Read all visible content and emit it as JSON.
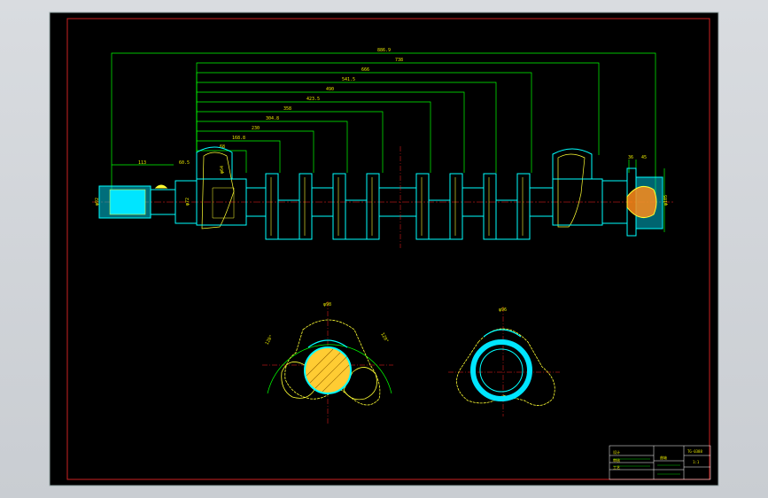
{
  "dimensions": {
    "overall": "886.9",
    "d738": "738",
    "d666": "666",
    "d541": "541.5",
    "d490": "490",
    "d423": "423.5",
    "d358": "358",
    "d304": "304.8",
    "d230": "230",
    "d168": "168.8",
    "d68": "68",
    "left_len": "113",
    "left_step": "60.5",
    "left_dia": "φ92",
    "left_mid": "φ72",
    "web_mid": "φ64",
    "right_a": "36",
    "right_b": "45",
    "right_dia": "φ105"
  },
  "section_views": {
    "left_top": "φ98",
    "left_angle_a": "120°",
    "left_angle_b": "120°",
    "right_top": "φ96"
  },
  "title_block": {
    "drawing_no": "TG-0388",
    "scale": "1:1",
    "part": "曲轴",
    "row_a": "设计",
    "row_b": "审核",
    "row_c": "工艺"
  },
  "colors": {
    "background": "#000000",
    "border": "#cc0000",
    "dimension": "#00ff00",
    "outline": "#00ffff",
    "centerline": "#ff2020",
    "hatch": "#ffff33",
    "text": "#e6e600"
  }
}
